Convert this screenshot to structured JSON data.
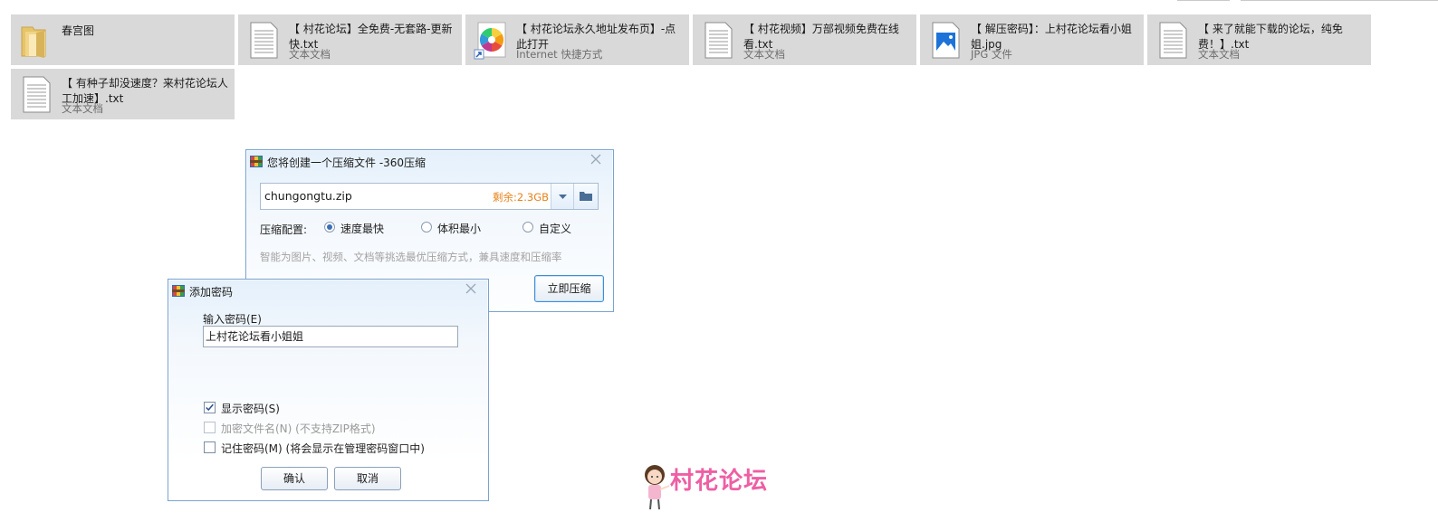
{
  "files": [
    {
      "name": "春宫图",
      "type": "",
      "icon": "folder-icon"
    },
    {
      "name": "【 村花论坛】全免费-无套路-更新快.txt",
      "type": "文本文档",
      "icon": "text-document-icon"
    },
    {
      "name": "【 村花论坛永久地址发布页】-点此打开",
      "type": "Internet 快捷方式",
      "icon": "internet-shortcut-icon"
    },
    {
      "name": "【 村花视频】万部视频免费在线看.txt",
      "type": "文本文档",
      "icon": "text-document-icon"
    },
    {
      "name": "【 解压密码】：上村花论坛看小姐姐.jpg",
      "type": "JPG 文件",
      "icon": "image-file-icon"
    },
    {
      "name": "【 来了就能下载的论坛，纯免费！】.txt",
      "type": "文本文档",
      "icon": "text-document-icon"
    },
    {
      "name": "【 有种子却没速度？来村花论坛人工加速】.txt",
      "type": "文本文档",
      "icon": "text-document-icon"
    }
  ],
  "compress_dialog": {
    "title": "您将创建一个压缩文件 -360压缩",
    "filename": "chungongtu.zip",
    "remaining": "剩余:2.3GB",
    "config_label": "压缩配置:",
    "options": [
      "速度最快",
      "体积最小",
      "自定义"
    ],
    "selected_option": "速度最快",
    "hint": "智能为图片、视频、文档等挑选最优压缩方式，兼具速度和压缩率",
    "compress_button": "立即压缩"
  },
  "password_dialog": {
    "title": "添加密码",
    "input_label": "输入密码(E)",
    "password_value": "上村花论坛看小姐姐",
    "show_password": {
      "label": "显示密码(S)",
      "checked": true,
      "enabled": true
    },
    "encrypt_names": {
      "label": "加密文件名(N) (不支持ZIP格式)",
      "checked": false,
      "enabled": false
    },
    "remember_password": {
      "label": "记住密码(M) (将会显示在管理密码窗口中)",
      "checked": false,
      "enabled": true
    },
    "ok_button": "确认",
    "cancel_button": "取消"
  },
  "logo": {
    "text": "村花论坛"
  },
  "colors": {
    "tile_bg": "#d9d9d9",
    "remain_orange": "#e8821a",
    "logo_pink": "#ee5fa3",
    "dialog_border": "#7aa3cf"
  }
}
